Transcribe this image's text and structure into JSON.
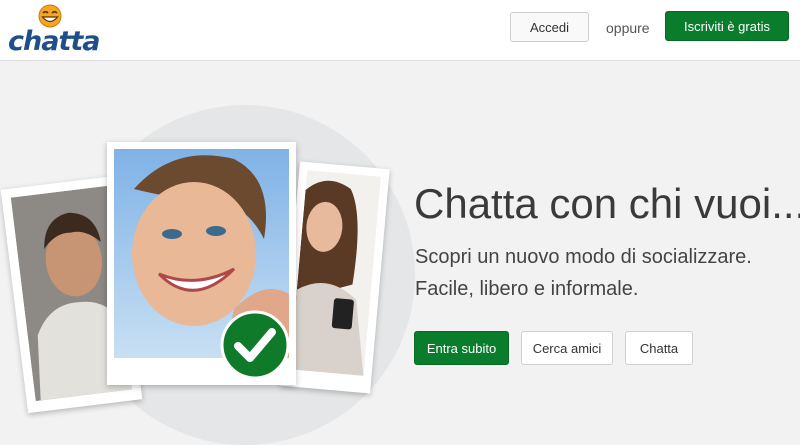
{
  "brand": {
    "name": "chatta",
    "logo_icon": "laughing-face-icon"
  },
  "header": {
    "login_label": "Accedi",
    "or_text": "oppure",
    "signup_label": "Iscriviti è gratis"
  },
  "hero": {
    "headline": "Chatta con chi vuoi...",
    "subline1": "Scopri un nuovo modo di socializzare.",
    "subline2": "Facile, libero e informale.",
    "primary_cta": "Entra subito",
    "find_friends": "Cerca amici",
    "chat": "Chatta"
  },
  "colors": {
    "brand_blue": "#1f4f8a",
    "accent_green": "#0a7d2c",
    "logo_orange": "#f4a623"
  }
}
